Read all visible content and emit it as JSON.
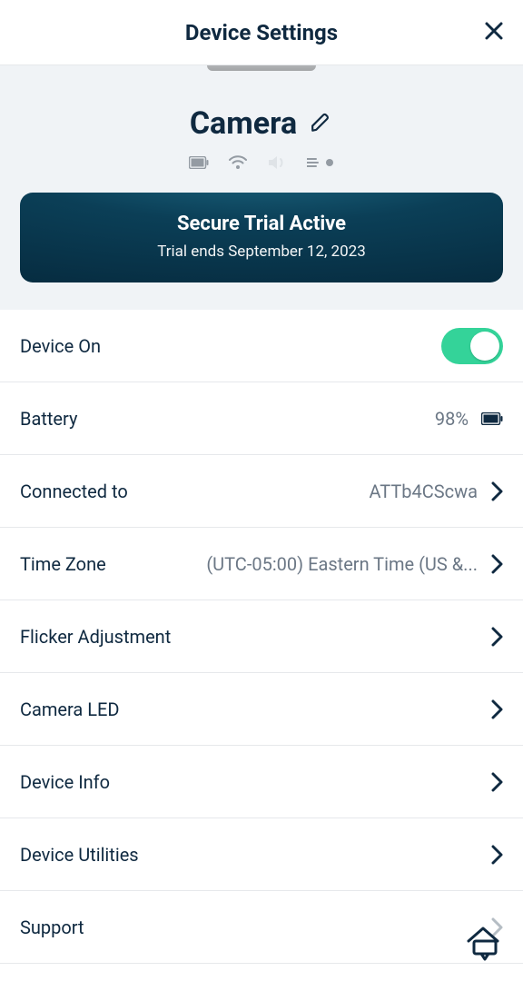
{
  "header": {
    "title": "Device Settings"
  },
  "device": {
    "name": "Camera"
  },
  "banner": {
    "title": "Secure Trial Active",
    "subtitle": "Trial ends September 12, 2023"
  },
  "rows": {
    "device_on": {
      "label": "Device On"
    },
    "battery": {
      "label": "Battery",
      "value": "98%"
    },
    "connected_to": {
      "label": "Connected to",
      "value": "ATTb4CScwa"
    },
    "time_zone": {
      "label": "Time Zone",
      "value": "(UTC-05:00) Eastern Time (US &..."
    },
    "flicker": {
      "label": "Flicker Adjustment"
    },
    "camera_led": {
      "label": "Camera LED"
    },
    "device_info": {
      "label": "Device Info"
    },
    "device_utilities": {
      "label": "Device Utilities"
    },
    "support": {
      "label": "Support"
    }
  }
}
